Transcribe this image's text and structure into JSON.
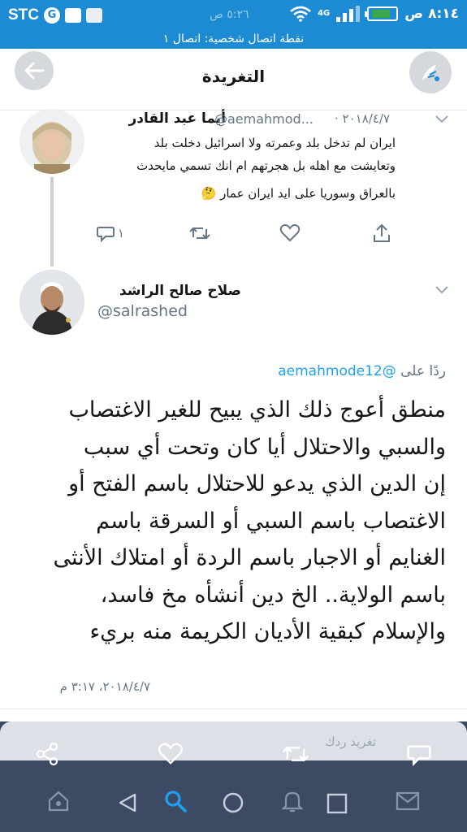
{
  "status_bar": {
    "carrier": "STC",
    "carrier_badge": "G",
    "ghost_time": "٥:٢٦ ص",
    "network_type": "4G",
    "time": "٨:١٤ ص"
  },
  "hotspot_banner": "نقطة اتصال شخصية: اتصال ١",
  "header": {
    "title": "التغريدة"
  },
  "parent_tweet": {
    "name": "أيما عبد القادر",
    "handle": "@aemahmod...",
    "date": "٢٠١٨/٤/٧ ·",
    "text_lines": [
      "ايران لم تدخل بلد وعمرته ولا اسرائيل دخلت بلد",
      "وتعايشت مع اهله بل هجرتهم ام انك تسمي مايحدث",
      "بالعراق وسوريا على ايد ايران عمار"
    ],
    "emoji": "🤔",
    "reply_count": "١"
  },
  "main_tweet": {
    "name": "صلاح صالح الراشد",
    "handle": "@salrashed",
    "reply_prefix": "ردًا على",
    "reply_handle": "@aemahmode12",
    "text_lines": [
      "منطق أعوج ذلك الذي يبيح للغير الاغتصاب",
      "والسبي والاحتلال أيا كان وتحت أي سبب",
      "إن الدين الذي يدعو للاحتلال باسم الفتح أو",
      "الاغتصاب باسم السبي أو السرقة باسم",
      "الغنايم أو الاجبار باسم الردة أو امتلاك الأنثى",
      "باسم الولاية.. الخ دين أنشأه مخ فاسد،",
      "والإسلام كبقية الأديان الكريمة منه بريء"
    ],
    "timestamp": "٢٠١٨/٤/٧، ٣:١٧ م"
  },
  "reply_bar": {
    "placeholder": "تغريد ردك"
  },
  "colors": {
    "status_bar": "#1d8bd3",
    "link": "#1da1f2",
    "muted": "#657786",
    "bottom_bar": "#3c4a63"
  },
  "icons": {
    "header_left": "arrow-left-icon",
    "header_right": "compose-icon",
    "actions": [
      "reply-icon",
      "retweet-icon",
      "like-icon",
      "share-icon"
    ],
    "bottom_actions": [
      "share-icon",
      "like-icon",
      "retweet-icon",
      "reply-icon"
    ],
    "navigation": [
      "home-icon",
      "back-icon",
      "search-icon",
      "home-button-icon",
      "notifications-icon",
      "recents-icon",
      "messages-icon"
    ]
  }
}
